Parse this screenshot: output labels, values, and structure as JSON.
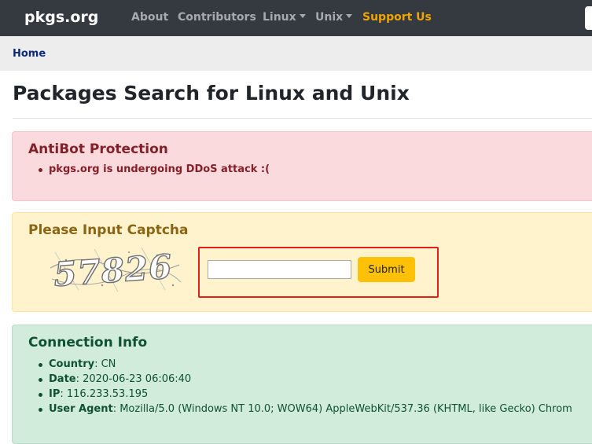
{
  "navbar": {
    "brand": "pkgs.org",
    "links": [
      "About",
      "Contributors",
      "Linux",
      "Unix",
      "Support Us"
    ]
  },
  "breadcrumb": {
    "home": "Home"
  },
  "page_title": "Packages Search for Linux and Unix",
  "antibot": {
    "heading": "AntiBot Protection",
    "message": "pkgs.org is undergoing DDoS attack :("
  },
  "captcha": {
    "heading": "Please Input Captcha",
    "image_text": "57826",
    "input_value": "",
    "submit_label": "Submit"
  },
  "connection": {
    "heading": "Connection Info",
    "items": [
      {
        "label": "Country",
        "value": ": CN"
      },
      {
        "label": "Date",
        "value": ": 2020-06-23 06:06:40"
      },
      {
        "label": "IP",
        "value": ": 116.233.53.195"
      },
      {
        "label": "User Agent",
        "value": ": Mozilla/5.0 (Windows NT 10.0; WOW64) AppleWebKit/537.36 (KHTML, like Gecko) Chrom"
      }
    ]
  },
  "colors": {
    "navbar": "#343a40",
    "support_link": "#f0a500",
    "danger_bg": "#fadadd",
    "warning_bg": "#fff3cd",
    "success_bg": "#d1ecdb",
    "submit_button": "#ffc107",
    "highlight_box": "#e0201b"
  }
}
